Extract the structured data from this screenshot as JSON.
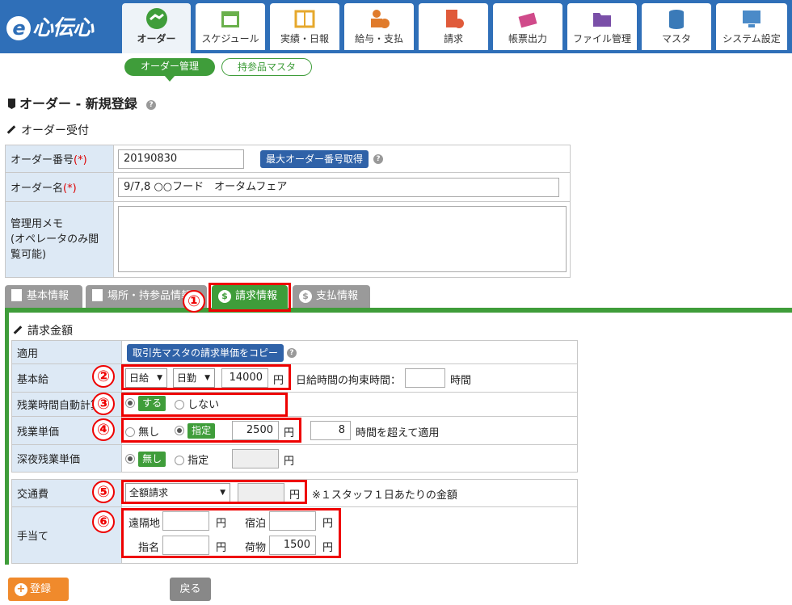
{
  "app": {
    "logo": "心伝心",
    "logo_e": "e"
  },
  "nav": [
    {
      "label": "オーダー",
      "icon": "handshake-icon",
      "color": "#3f9d3a"
    },
    {
      "label": "スケジュール",
      "icon": "calendar-icon",
      "color": "#6ab04c"
    },
    {
      "label": "実績・日報",
      "icon": "book-icon",
      "color": "#e6a82c"
    },
    {
      "label": "給与・支払",
      "icon": "person-coin-icon",
      "color": "#e07b2c"
    },
    {
      "label": "請求",
      "icon": "building-coin-icon",
      "color": "#e05a3a"
    },
    {
      "label": "帳票出力",
      "icon": "documents-icon",
      "color": "#d04a8a"
    },
    {
      "label": "ファイル管理",
      "icon": "folder-icon",
      "color": "#7a4fa8"
    },
    {
      "label": "マスタ",
      "icon": "database-icon",
      "color": "#3a7ab8"
    },
    {
      "label": "システム設定",
      "icon": "monitor-gear-icon",
      "color": "#4a8ac8"
    }
  ],
  "subnav": {
    "active": "オーダー管理",
    "other": "持参品マスタ"
  },
  "page_title": "オーダー - 新規登録",
  "order_section": {
    "title": "オーダー受付",
    "order_number_label": "オーダー番号",
    "required_mark": "(*)",
    "order_number_value": "20190830",
    "max_number_button": "最大オーダー番号取得",
    "order_name_label": "オーダー名",
    "order_name_value": "9/7,8 ○○フード　オータムフェア",
    "memo_label": "管理用メモ\n(オペレータのみ閲覧可能)",
    "memo_value": ""
  },
  "tabs": [
    {
      "label": "基本情報",
      "icon": "edit-doc-icon"
    },
    {
      "label": "場所・持参品情報",
      "icon": "edit-doc-icon"
    },
    {
      "label": "請求情報",
      "icon": "dollar-icon"
    },
    {
      "label": "支払情報",
      "icon": "dollar-icon"
    }
  ],
  "billing": {
    "section_title": "請求金額",
    "apply_label": "適用",
    "copy_button": "取引先マスタの請求単価をコピー",
    "base_pay_label": "基本給",
    "pay_type_1": "日給",
    "pay_type_2": "日勤",
    "base_amount": "14000",
    "yen": "円",
    "daily_time_label": "日給時間の拘束時間：",
    "daily_time_value": "",
    "hours_unit": "時間",
    "overtime_auto_label": "残業時間自動計算",
    "opt_yes": "する",
    "opt_no": "しない",
    "overtime_rate_label": "残業単価",
    "opt_none": "無し",
    "opt_specified": "指定",
    "overtime_amount": "2500",
    "overtime_hours": "8",
    "overtime_hours_suffix": "時間を超えて適用",
    "night_rate_label": "深夜残業単価",
    "night_amount": "",
    "transport_label": "交通費",
    "transport_option": "全額請求",
    "transport_amount": "",
    "transport_note": "※１スタッフ１日あたりの金額",
    "allowance_label": "手当て",
    "remote_label": "遠隔地",
    "remote_value": "",
    "lodging_label": "宿泊",
    "lodging_value": "",
    "nomination_label": "指名",
    "nomination_value": "",
    "baggage_label": "荷物",
    "baggage_value": "1500"
  },
  "callouts": [
    "①",
    "②",
    "③",
    "④",
    "⑤",
    "⑥"
  ],
  "buttons": {
    "register": "登録",
    "back": "戻る"
  }
}
